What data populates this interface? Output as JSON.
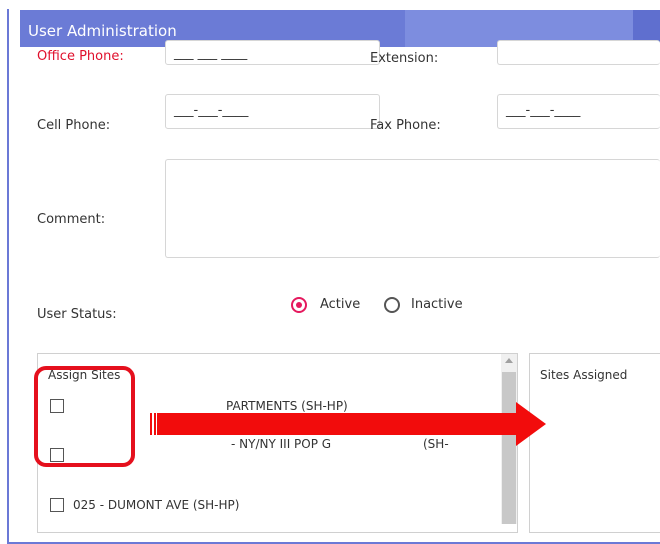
{
  "header": {
    "title": "User Administration"
  },
  "form": {
    "office_phone_label": "Office Phone:",
    "office_phone_value": "___ ___ ____",
    "extension_label": "Extension:",
    "cell_phone_label": "Cell Phone:",
    "cell_phone_value": "___-___-____",
    "fax_phone_label": "Fax Phone:",
    "fax_phone_value": "___-___-____",
    "comment_label": "Comment:",
    "comment_value": "",
    "user_status_label": "User Status:",
    "status_options": [
      {
        "label": "Active",
        "selected": true
      },
      {
        "label": "Inactive",
        "selected": false
      }
    ]
  },
  "assign_sites": {
    "title": "Assign Sites",
    "items": [
      {
        "label": "PARTMENTS (SH-HP)",
        "checked": false
      },
      {
        "label": "- NY/NY III POP G",
        "suffix": "(SH-",
        "checked": false
      },
      {
        "label": "025 - DUMONT AVE (SH-HP)",
        "checked": false
      }
    ]
  },
  "sites_assigned": {
    "title": "Sites Assigned"
  },
  "colors": {
    "accent": "#6b7bd6",
    "required_label": "#e0102c",
    "radio_selected": "#e5195e",
    "highlight": "#e5101d"
  }
}
